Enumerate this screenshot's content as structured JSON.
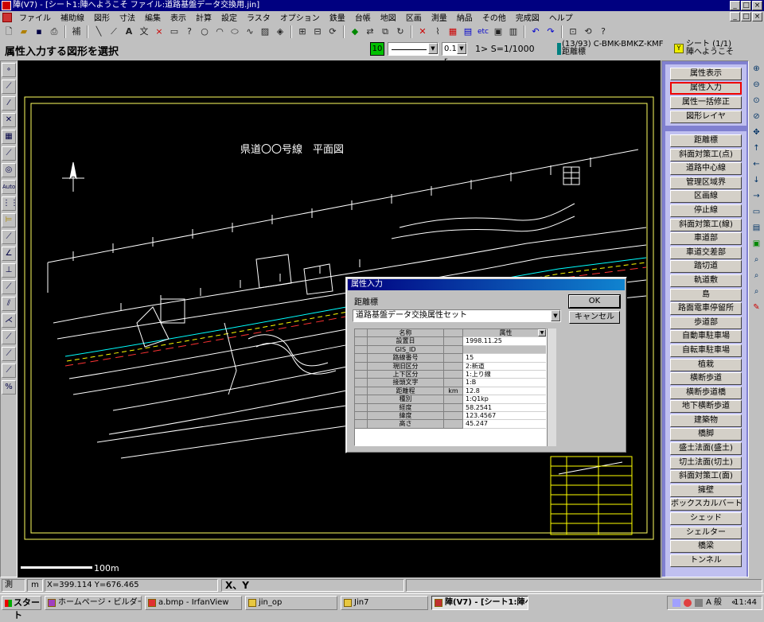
{
  "window": {
    "title": "陣(V7) - [シート1:陣へようこそ ファイル:道路基盤データ交換用.jin]"
  },
  "menu": [
    "ファイル",
    "補助線",
    "図形",
    "寸法",
    "編集",
    "表示",
    "計算",
    "設定",
    "ラスタ",
    "オプション",
    "鉄量",
    "台帳",
    "地図",
    "区画",
    "測量",
    "納品",
    "その他",
    "完成図",
    "ヘルプ"
  ],
  "toolbar": {
    "edit_label": "補",
    "text_label": "文",
    "etc_label": "etc"
  },
  "status": {
    "prompt": "属性入力する図形を選択",
    "layer_number": "10",
    "line_size": "0.13 r",
    "scale": "1> S=1/1000",
    "sheet_code": "(13/93) C-BMK-BMKZ-KMF",
    "layer_name": "距離標",
    "sheet_label": "シート (1/1)",
    "sheet_name": "陣へようこそ"
  },
  "drawing": {
    "title": "県道〇〇号線　平面図",
    "scalebar": "100m"
  },
  "right_panel": {
    "top_buttons": [
      "属性表示",
      "属性入力",
      "属性一括修正",
      "図形レイヤ"
    ],
    "layer_buttons": [
      "距離標",
      "斜面対策工(点)",
      "道路中心線",
      "管理区域界",
      "区画線",
      "停止線",
      "斜面対策工(線)",
      "車道部",
      "車道交差部",
      "踏切道",
      "軌道敷",
      "島",
      "路面電車停留所",
      "歩道部",
      "自動車駐車場",
      "自転車駐車場",
      "植栽",
      "横断歩道",
      "横断歩道橋",
      "地下横断歩道",
      "建築物",
      "橋脚",
      "盛土法面(盛土)",
      "切土法面(切土)",
      "斜面対策工(面)",
      "擁壁",
      "ボックスカルバート",
      "シェッド",
      "シェルター",
      "橋梁",
      "トンネル"
    ]
  },
  "dialog": {
    "title": "属性入力",
    "label": "距離標",
    "ok": "OK",
    "cancel": "キャンセル",
    "preset": "道路基盤データ交換属性セット",
    "grid_header": {
      "name": "名称",
      "value": "属性"
    },
    "rows": [
      {
        "name": "設置日",
        "unit": "",
        "value": "1998.11.25"
      },
      {
        "name": "GIS_ID",
        "unit": "",
        "value": ""
      },
      {
        "name": "路線番号",
        "unit": "",
        "value": "15"
      },
      {
        "name": "現旧区分",
        "unit": "",
        "value": "2:新道"
      },
      {
        "name": "上下区分",
        "unit": "",
        "value": "1:上り線"
      },
      {
        "name": "接頭文字",
        "unit": "",
        "value": "1:B"
      },
      {
        "name": "距離程",
        "unit": "km",
        "value": "12.8"
      },
      {
        "name": "種別",
        "unit": "",
        "value": "1:Q1kp"
      },
      {
        "name": "経度",
        "unit": "",
        "value": "58.2541"
      },
      {
        "name": "緯度",
        "unit": "",
        "value": "123.4567"
      },
      {
        "name": "高さ",
        "unit": "",
        "value": "45.247"
      }
    ]
  },
  "coords": {
    "mode": "測",
    "unit": "m",
    "readout": "X=399.114 Y=676.465",
    "axis": "X、Y"
  },
  "taskbar": {
    "start": "スタート",
    "tasks": [
      "ホームページ・ビルダー - [i...",
      "a.bmp - IrfanView",
      "jin_op",
      "Jin7",
      "陣(V7) - [シート1:陣へ..."
    ],
    "ime": "A 般",
    "clock": "11:44"
  }
}
